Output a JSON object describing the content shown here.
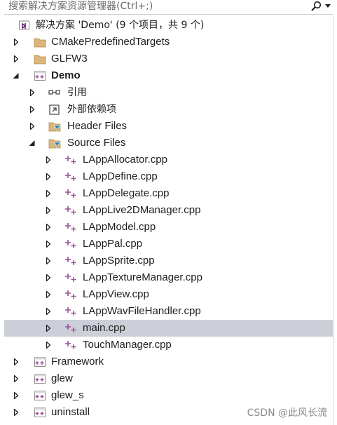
{
  "search": {
    "placeholder": "搜索解决方案资源管理器(Ctrl+;)"
  },
  "solution": {
    "label": "解决方案 'Demo' (9 个项目，共 9 个)"
  },
  "projects": {
    "cmake": "CMakePredefinedTargets",
    "glfw": "GLFW3",
    "demo": "Demo",
    "framework": "Framework",
    "glew": "glew",
    "glew_s": "glew_s",
    "uninstall": "uninstall"
  },
  "demo_children": {
    "references": "引用",
    "external_deps": "外部依赖项",
    "header_files": "Header Files",
    "source_files": "Source Files"
  },
  "source_files": [
    "LAppAllocator.cpp",
    "LAppDefine.cpp",
    "LAppDelegate.cpp",
    "LAppLive2DManager.cpp",
    "LAppModel.cpp",
    "LAppPal.cpp",
    "LAppSprite.cpp",
    "LAppTextureManager.cpp",
    "LAppView.cpp",
    "LAppWavFileHandler.cpp",
    "main.cpp",
    "TouchManager.cpp"
  ],
  "selected_file": "main.cpp",
  "watermark": "CSDN @此风长流",
  "icons": {
    "search": "search-icon",
    "solution": "vs-solution-icon",
    "folder": "folder-icon",
    "project": "cpp-project-icon",
    "reference": "reference-icon",
    "external": "external-deps-icon",
    "filter": "filter-folder-icon",
    "cpp": "cpp-file-icon"
  },
  "colors": {
    "selection": "#ccced8",
    "folder": "#dcb67a",
    "cpp_plus": "#9b4f96",
    "vs_purple": "#68217a"
  }
}
